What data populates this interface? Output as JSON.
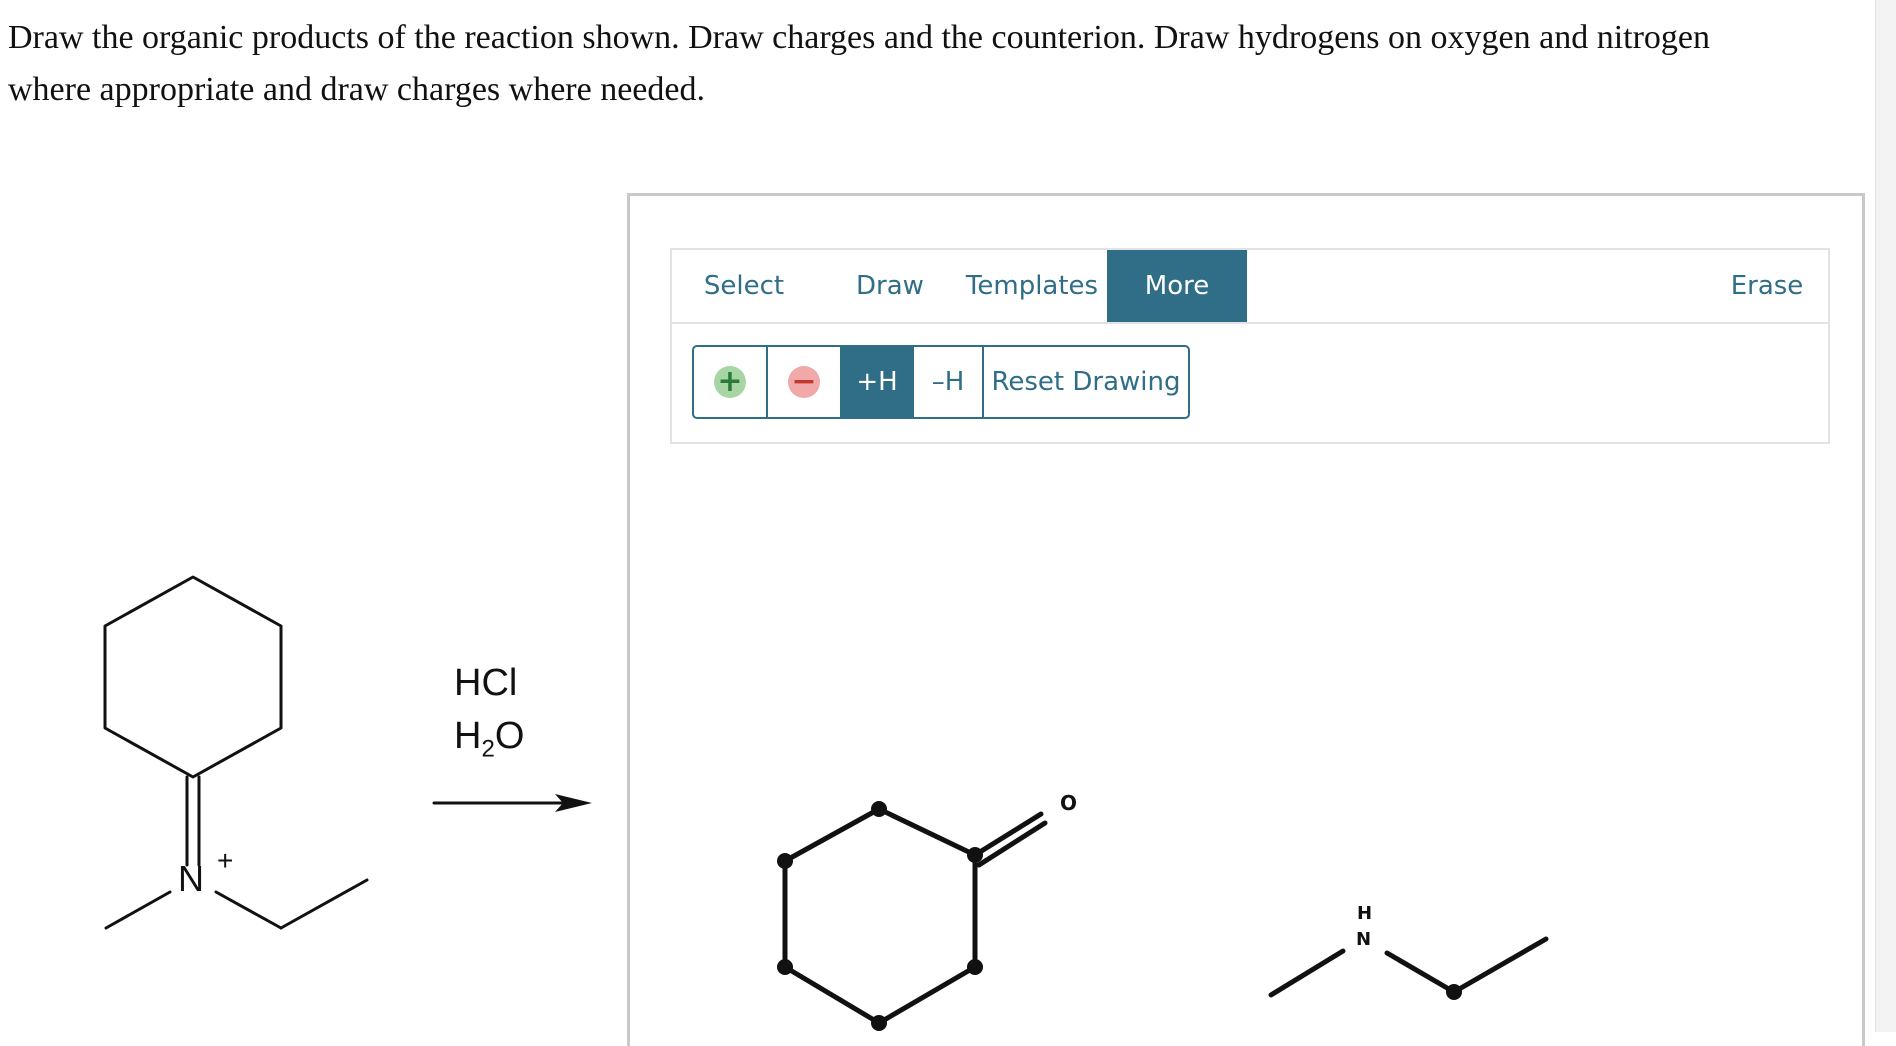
{
  "question": {
    "line1": "Draw the organic products of the reaction shown. Draw charges and the counterion. Draw hydrogens on oxygen and nitrogen",
    "line2": "where appropriate and draw charges where needed."
  },
  "reaction": {
    "reagent1": "HCl",
    "reagent2_main": "H",
    "reagent2_sub": "2",
    "reagent2_end": "O",
    "nitrogen_label": "N",
    "charge_label": "+"
  },
  "toolbar": {
    "tabs": [
      {
        "label": "Select"
      },
      {
        "label": "Draw"
      },
      {
        "label": "Templates"
      },
      {
        "label": "More",
        "active": true
      }
    ],
    "erase_label": "Erase",
    "sub_buttons": {
      "positive_icon": "+",
      "negative_icon": "−",
      "add_h": "+H",
      "remove_h": "–H",
      "reset": "Reset Drawing"
    }
  },
  "canvas": {
    "oxygen_label": "O",
    "amine_h_label": "H",
    "amine_n_label": "N"
  },
  "colors": {
    "accent": "#2f6e86",
    "positive_charge": "#a8d5a4",
    "negative_charge": "#f0a8a8"
  }
}
